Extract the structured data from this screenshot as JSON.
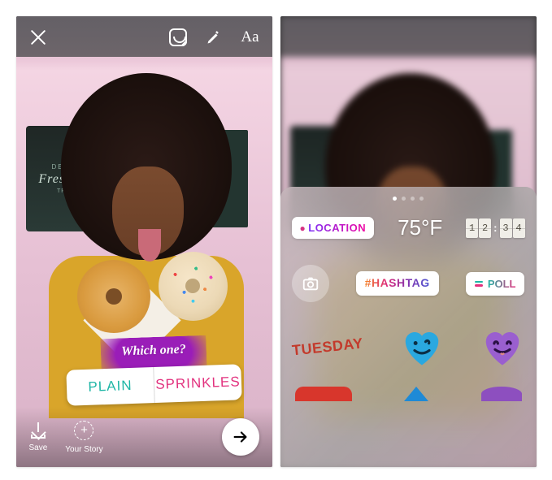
{
  "left": {
    "signage": {
      "line1": "DELICIO",
      "line2": "Fresh Pies",
      "line3": "TREATS"
    },
    "topbar": {
      "close": "close",
      "sticker": "sticker",
      "draw": "draw",
      "text_tool": "Aa"
    },
    "poll": {
      "question": "Which one?",
      "option_a": "PLAIN",
      "option_b": "SPRINKLES",
      "color_a": "#1fb6a6",
      "color_b": "#e2317e"
    },
    "bottom": {
      "save": "Save",
      "your_story": "Your Story",
      "send": "send"
    }
  },
  "right": {
    "pager": {
      "count": 4,
      "active": 0
    },
    "row1": {
      "location_label": "LOCATION",
      "temperature": "75°F",
      "clock": [
        "1",
        "2",
        "3",
        "4"
      ]
    },
    "row2": {
      "camera": "camera",
      "hashtag": "#HASHTAG",
      "poll_label": "POLL",
      "poll_colors": [
        "#1fb6a6",
        "#e2317e"
      ]
    },
    "row3": {
      "day": "TUESDAY",
      "heart_blue": "#2aa8e0",
      "heart_purple": "#9a5fcf"
    }
  }
}
